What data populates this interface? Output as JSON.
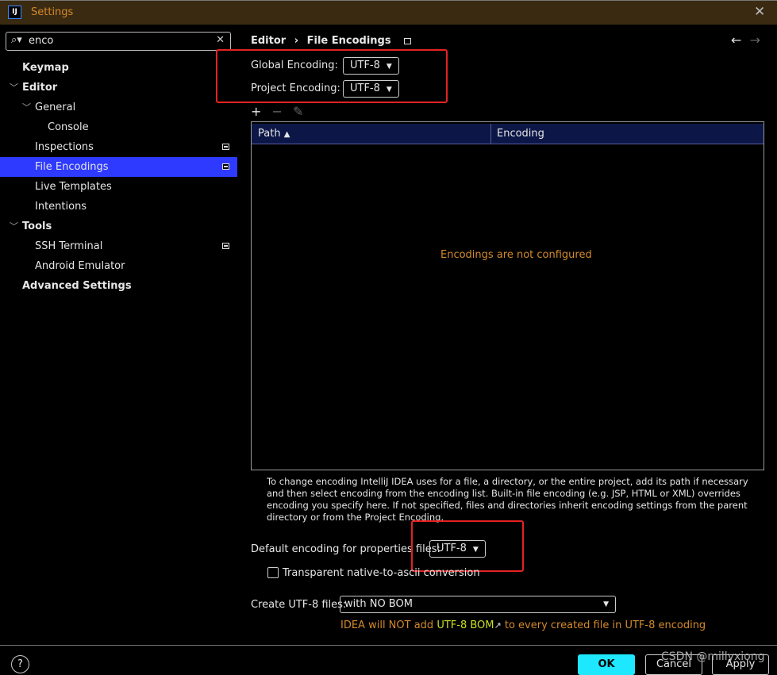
{
  "window": {
    "title": "Settings",
    "app_icon": "IJ",
    "close": "✕"
  },
  "search": {
    "value": "enco"
  },
  "sidebar": {
    "items": [
      {
        "label": "Keymap"
      },
      {
        "label": "Editor"
      },
      {
        "label": "General"
      },
      {
        "label": "Console"
      },
      {
        "label": "Inspections"
      },
      {
        "label": "File Encodings"
      },
      {
        "label": "Live Templates"
      },
      {
        "label": "Intentions"
      },
      {
        "label": "Tools"
      },
      {
        "label": "SSH Terminal"
      },
      {
        "label": "Android Emulator"
      },
      {
        "label": "Advanced Settings"
      }
    ]
  },
  "breadcrumb": {
    "parent": "Editor",
    "sep": "›",
    "current": "File Encodings"
  },
  "global": {
    "label": "Global Encoding:",
    "value": "UTF-8"
  },
  "project": {
    "label": "Project Encoding:",
    "value": "UTF-8"
  },
  "table": {
    "columns": [
      "Path",
      "Encoding"
    ],
    "sort_indicator": "▲",
    "empty": "Encodings are not configured"
  },
  "help_text": "To change encoding IntelliJ IDEA uses for a file, a directory, or the entire project, add its path if necessary and then select encoding from the encoding list. Built-in file encoding (e.g. JSP, HTML or XML) overrides encoding you specify here. If not specified, files and directories inherit encoding settings from the parent directory or from the Project Encoding.",
  "properties": {
    "label": "Default encoding for properties files:",
    "value": "UTF-8"
  },
  "transparent": {
    "label": "Transparent native-to-ascii conversion",
    "checked": false
  },
  "create_utf8": {
    "label": "Create UTF-8 files:",
    "value": "with NO BOM"
  },
  "bom_note": {
    "before": "IDEA will NOT add",
    "link": "UTF-8 BOM",
    "arrow": "↗",
    "after": "to every created file in UTF-8 encoding"
  },
  "buttons": {
    "ok": "OK",
    "cancel": "Cancel",
    "apply": "Apply",
    "help": "?"
  },
  "watermark": "CSDN @millyxiong",
  "colors": {
    "accent": "#2e3aff",
    "ok": "#1ee8ff",
    "warning": "#d4892b",
    "highlight": "#e52222"
  }
}
